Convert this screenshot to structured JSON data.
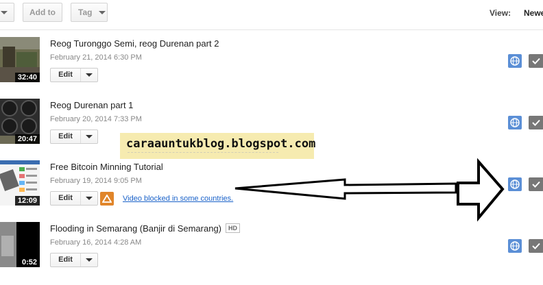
{
  "toolbar": {
    "add_to_label": "Add to",
    "tag_label": "Tag",
    "view_label": "View:",
    "view_value": "Newest"
  },
  "videos": [
    {
      "title": "Reog Turonggo Semi, reog Durenan part 2",
      "date": "February 21, 2014 6:30 PM",
      "duration": "32:40",
      "edit_label": "Edit"
    },
    {
      "title": "Reog Durenan part 1",
      "date": "February 20, 2014 7:33 PM",
      "duration": "20:47",
      "edit_label": "Edit"
    },
    {
      "title": "Free Bitcoin Minning Tutorial",
      "date": "February 19, 2014 9:05 PM",
      "duration": "12:09",
      "edit_label": "Edit",
      "blocked_text": "Video blocked in some countries."
    },
    {
      "title": "Flooding in Semarang (Banjir di Semarang)",
      "date": "February 16, 2014 4:28 AM",
      "duration": "0:52",
      "edit_label": "Edit",
      "hd_badge": "HD"
    }
  ],
  "overlay": {
    "watermark": "caraauntukblog.blogspot.com"
  },
  "colors": {
    "globe": "#5b8fd6",
    "check": "#777777",
    "warning": "#e0852a",
    "link": "#1a62c9",
    "overlay_bg": "#f6ebb0"
  },
  "icons": [
    "globe-icon",
    "checkbox-checked-icon",
    "warning-triangle-icon",
    "arrow-right-icon",
    "arrow-left-icon",
    "caret-down-icon"
  ]
}
